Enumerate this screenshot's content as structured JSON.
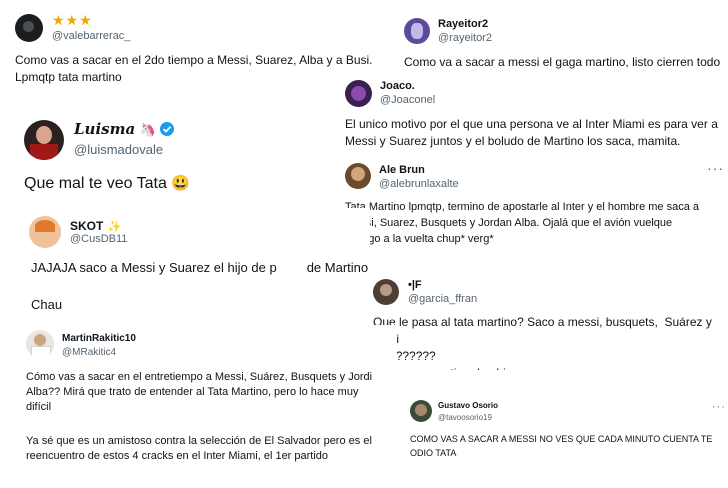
{
  "tweets": [
    {
      "name": "",
      "handle": "@valebarrerac_",
      "rating_icon": "star-icon",
      "rating": "★★★",
      "text": "Como vas a sacar en el 2do tiempo a Messi, Suarez, Alba y a Busi.\nLpmqtp tata martino"
    },
    {
      "name": "Rayeitor2",
      "handle": "@rayeitor2",
      "text": "Como va a sacar a messi el gaga martino, listo cierren todo"
    },
    {
      "name": "Joaco.",
      "handle": "@Joaconel",
      "text": "El unico motivo por el que una persona ve al Inter Miami es para ver a\nMessi y Suarez juntos y el boludo de Martino los saca, mamita."
    },
    {
      "name": "Luisma",
      "name_emoji": "🦄",
      "verified_icon": "verified-badge-icon",
      "handle": "@luismadovale",
      "text": "Que mal te veo Tata",
      "text_emoji": "😃"
    },
    {
      "name": "Ale Brun",
      "handle": "@alebrunlaxalte",
      "more": "···",
      "text": "Tata Martino lpmqtp, termino de apostarle al Inter y el hombre me saca a\nMessi, Suarez, Busquets y Jordan Alba. Ojalá que el avión vuelque\ncontigo a la vuelta chup* verg*"
    },
    {
      "name": "SKOT",
      "name_emoji": "✨",
      "handle": "@CusDB11",
      "text_a": "JAJAJA saco a Messi y Suarez el hijo de p",
      "text_b": "de Martino",
      "text_c": "Chau"
    },
    {
      "name": "•|F",
      "handle": "@garcia_ffran",
      "text": "Que le pasa al tata martino? Saco a messi, busquets,  Suárez y Jordi\nalba??????\nSaquen a ese tipo de ahi"
    },
    {
      "name": "MartinRakitic10",
      "handle": "@MRakitic4",
      "text_a": "Cómo vas a sacar en el entretiempo a Messi, Suárez, Busquets y Jordi\nAlba?? Mirá que trato de entender al Tata Martino, pero lo hace muy\ndifícil",
      "text_b": "Ya sé que es un amistoso contra la selección de El Salvador pero es el\nreencuentro de estos 4 cracks en el Inter Miami, el 1er partido"
    },
    {
      "name": "Gustavo Osorio",
      "handle": "@tavoosorio19",
      "more": "···",
      "text": "COMO VAS A SACAR A MESSI NO VES QUE CADA MINUTO CUENTA TE\nODIO TATA"
    }
  ],
  "colors": {
    "verified": "#1d9bf0",
    "star": "#f4a300"
  }
}
